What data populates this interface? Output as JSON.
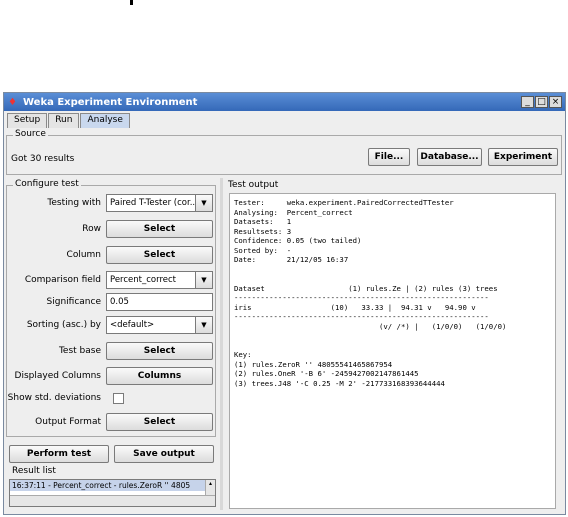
{
  "window": {
    "title": "Weka Experiment Environment",
    "minimize": "_",
    "maximize": "□",
    "close": "×"
  },
  "tabs": [
    {
      "label": "Setup"
    },
    {
      "label": "Run"
    },
    {
      "label": "Analyse"
    }
  ],
  "source": {
    "label": "Source",
    "status": "Got 30 results",
    "file_button": "File...",
    "database_button": "Database...",
    "experiment_button": "Experiment"
  },
  "configure": {
    "label": "Configure test",
    "testing_with_label": "Testing with",
    "testing_with_value": "Paired T-Tester (cor...",
    "row_label": "Row",
    "row_button": "Select",
    "column_label": "Column",
    "column_button": "Select",
    "comparison_label": "Comparison field",
    "comparison_value": "Percent_correct",
    "significance_label": "Significance",
    "significance_value": "0.05",
    "sorting_label": "Sorting (asc.) by",
    "sorting_value": "<default>",
    "test_base_label": "Test base",
    "test_base_button": "Select",
    "displayed_columns_label": "Displayed Columns",
    "displayed_columns_button": "Columns",
    "show_std_label": "Show std. deviations",
    "show_std_checked": false,
    "output_format_label": "Output Format",
    "output_format_button": "Select",
    "perform_test_button": "Perform test",
    "save_output_button": "Save output"
  },
  "result_list": {
    "label": "Result list",
    "items": [
      "16:37:11 - Percent_correct - rules.ZeroR '' 4805"
    ]
  },
  "test_output": {
    "label": "Test output",
    "text": "Tester:     weka.experiment.PairedCorrectedTTester\nAnalysing:  Percent_correct\nDatasets:   1\nResultsets: 3\nConfidence: 0.05 (two tailed)\nSorted by:  -\nDate:       21/12/05 16:37\n\n\nDataset                   (1) rules.Ze | (2) rules (3) trees\n----------------------------------------------------------\niris                  (10)   33.33 |  94.31 v   94.90 v\n----------------------------------------------------------\n                                 (v/ /*) |   (1/0/0)   (1/0/0)\n\n\nKey:\n(1) rules.ZeroR '' 48055541465867954\n(2) rules.OneR '-B 6' -2459427002147861445\n(3) trees.J48 '-C 0.25 -M 2' -217733168393644444"
  },
  "colors": {
    "titlebar": "#3468b8",
    "active_tab": "#c9d8ee",
    "selection": "#c6d3ea"
  }
}
